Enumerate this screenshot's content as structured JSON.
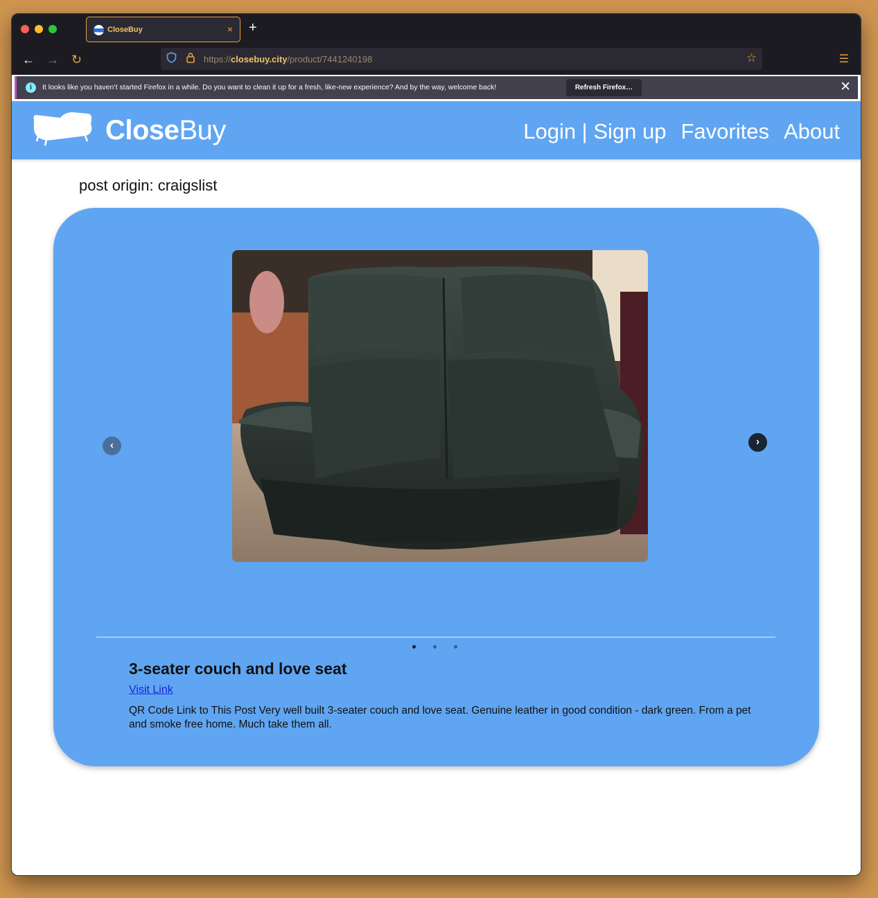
{
  "browser": {
    "tab_title": "CloseBuy",
    "tab_close": "×",
    "new_tab": "+",
    "url_prefix": "https://",
    "url_host": "closebuy.city",
    "url_path": "/product/7441240198",
    "notification_text": "It looks like you haven’t started Firefox in a while. Do you want to clean it up for a fresh, like-new experience? And by the way, welcome back!",
    "notification_button": "Refresh Firefox…",
    "notification_close": "✕"
  },
  "site": {
    "brand_bold": "Close",
    "brand_light": "Buy",
    "nav": {
      "login": "Login | Sign up",
      "favorites": "Favorites",
      "about": "About"
    },
    "accent_color": "#60a5f2"
  },
  "post": {
    "origin": "post origin: craigslist",
    "title": "3-seater couch and love seat",
    "visit_link": "Visit Link",
    "description": "QR Code Link to This Post Very well built 3-seater couch and love seat. Genuine leather in good condition - dark green. From a pet and smoke free home. Much take them all.",
    "carousel": {
      "slide_count": 3,
      "active_index": 0,
      "prev_icon": "‹",
      "next_icon": "›"
    }
  }
}
